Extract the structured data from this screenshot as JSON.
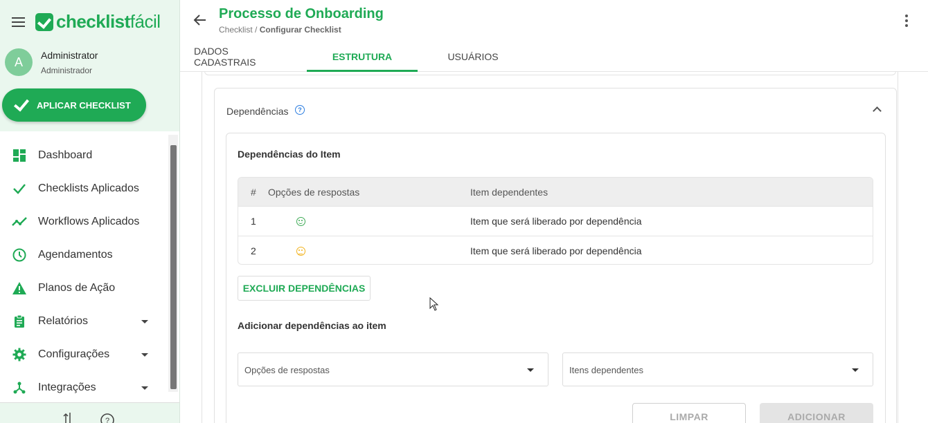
{
  "sidebar": {
    "logo_bold": "checklist",
    "logo_light": "fácil",
    "user": {
      "initial": "A",
      "name": "Administrator",
      "role": "Administrador"
    },
    "apply_button": "APLICAR CHECKLIST",
    "items": [
      {
        "label": "Dashboard",
        "icon": "dashboard-icon",
        "has_submenu": false
      },
      {
        "label": "Checklists Aplicados",
        "icon": "check-icon",
        "has_submenu": false
      },
      {
        "label": "Workflows Aplicados",
        "icon": "trending-icon",
        "has_submenu": false
      },
      {
        "label": "Agendamentos",
        "icon": "clock-icon",
        "has_submenu": false
      },
      {
        "label": "Planos de Ação",
        "icon": "warning-icon",
        "has_submenu": false
      },
      {
        "label": "Relatórios",
        "icon": "clipboard-icon",
        "has_submenu": true
      },
      {
        "label": "Configurações",
        "icon": "gear-icon",
        "has_submenu": true
      },
      {
        "label": "Integrações",
        "icon": "integration-icon",
        "has_submenu": true
      }
    ]
  },
  "header": {
    "title": "Processo de Onboarding",
    "breadcrumb_root": "Checklist",
    "breadcrumb_sep": " / ",
    "breadcrumb_current": "Configurar Checklist",
    "tabs": [
      {
        "label": "DADOS CADASTRAIS",
        "active": false
      },
      {
        "label": "ESTRUTURA",
        "active": true
      },
      {
        "label": "USUÁRIOS",
        "active": false
      }
    ]
  },
  "dependencies": {
    "section_title": "Dependências",
    "help_icon": "?",
    "inner_title": "Dependências do Item",
    "table": {
      "headers": [
        "#",
        "Opções de respostas",
        "Item dependentes"
      ],
      "rows": [
        {
          "index": "1",
          "option_icon": "happy-face-icon",
          "dependent": "Item que será liberado por dependência"
        },
        {
          "index": "2",
          "option_icon": "neutral-face-icon",
          "dependent": "Item que será liberado por dependência"
        }
      ]
    },
    "delete_button": "EXCLUIR DEPENDÊNCIAS",
    "add_title": "Adicionar dependências ao item",
    "select_options_placeholder": "Opções de respostas",
    "select_items_placeholder": "Itens dependentes",
    "clear_button": "LIMPAR",
    "add_button": "ADICIONAR"
  },
  "colors": {
    "brand": "#1faa55",
    "happy": "#3daa55",
    "neutral": "#f2b21b",
    "help": "#2b7de0"
  }
}
